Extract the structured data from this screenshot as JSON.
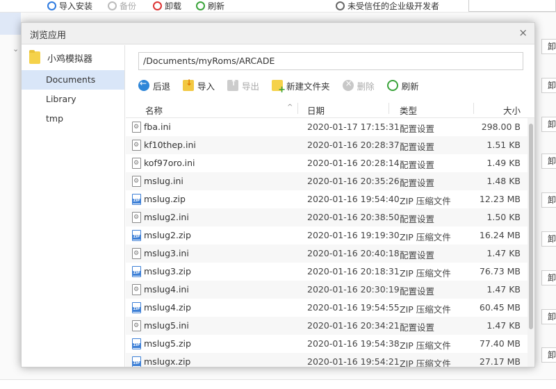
{
  "background": {
    "toolbar": [
      {
        "label": "导入安装",
        "icon": "install-icon",
        "disabled": false
      },
      {
        "label": "备份",
        "icon": "backup-icon",
        "disabled": true
      },
      {
        "label": "卸载",
        "icon": "uninstall-icon",
        "disabled": false
      },
      {
        "label": "刷新",
        "icon": "refresh-icon",
        "disabled": false
      }
    ],
    "notice": "未受信任的企业级开发者",
    "side_button_label": "卸"
  },
  "dialog": {
    "title": "浏览应用",
    "close_label": "×",
    "sidebar": {
      "root": "小鸡模拟器",
      "items": [
        "Documents",
        "Library",
        "tmp"
      ],
      "selected": "Documents"
    },
    "path": "/Documents/myRoms/ARCADE",
    "actions": [
      {
        "label": "后退",
        "icon": "back-icon",
        "disabled": false
      },
      {
        "label": "导入",
        "icon": "import-icon",
        "disabled": false
      },
      {
        "label": "导出",
        "icon": "export-icon",
        "disabled": true
      },
      {
        "label": "新建文件夹",
        "icon": "new-folder-icon",
        "disabled": false
      },
      {
        "label": "删除",
        "icon": "delete-icon",
        "disabled": true
      },
      {
        "label": "刷新",
        "icon": "refresh-icon",
        "disabled": false
      }
    ],
    "columns": {
      "name": "名称",
      "date": "日期",
      "type": "类型",
      "size": "大小"
    },
    "files": [
      {
        "name": "fba.ini",
        "date": "2020-01-17 17:15:31",
        "type": "配置设置",
        "size": "298.00 B",
        "kind": "ini"
      },
      {
        "name": "kf10thep.ini",
        "date": "2020-01-16 20:28:37",
        "type": "配置设置",
        "size": "1.51 KB",
        "kind": "ini"
      },
      {
        "name": "kof97oro.ini",
        "date": "2020-01-16 20:28:14",
        "type": "配置设置",
        "size": "1.49 KB",
        "kind": "ini"
      },
      {
        "name": "mslug.ini",
        "date": "2020-01-16 20:35:26",
        "type": "配置设置",
        "size": "1.48 KB",
        "kind": "ini"
      },
      {
        "name": "mslug.zip",
        "date": "2020-01-16 19:54:40",
        "type": "ZIP 压缩文件",
        "size": "12.23 MB",
        "kind": "zip"
      },
      {
        "name": "mslug2.ini",
        "date": "2020-01-16 20:38:50",
        "type": "配置设置",
        "size": "1.50 KB",
        "kind": "ini"
      },
      {
        "name": "mslug2.zip",
        "date": "2020-01-16 19:19:30",
        "type": "ZIP 压缩文件",
        "size": "16.24 MB",
        "kind": "zip"
      },
      {
        "name": "mslug3.ini",
        "date": "2020-01-16 20:40:18",
        "type": "配置设置",
        "size": "1.47 KB",
        "kind": "ini"
      },
      {
        "name": "mslug3.zip",
        "date": "2020-01-16 20:18:31",
        "type": "ZIP 压缩文件",
        "size": "76.73 MB",
        "kind": "zip"
      },
      {
        "name": "mslug4.ini",
        "date": "2020-01-16 20:30:19",
        "type": "配置设置",
        "size": "1.47 KB",
        "kind": "ini"
      },
      {
        "name": "mslug4.zip",
        "date": "2020-01-16 19:54:55",
        "type": "ZIP 压缩文件",
        "size": "60.45 MB",
        "kind": "zip"
      },
      {
        "name": "mslug5.ini",
        "date": "2020-01-16 20:34:21",
        "type": "配置设置",
        "size": "1.47 KB",
        "kind": "ini"
      },
      {
        "name": "mslug5.zip",
        "date": "2020-01-16 19:54:38",
        "type": "ZIP 压缩文件",
        "size": "77.40 MB",
        "kind": "zip"
      },
      {
        "name": "mslugx.zip",
        "date": "2020-01-16 19:54:21",
        "type": "ZIP 压缩文件",
        "size": "27.17 MB",
        "kind": "zip"
      }
    ]
  }
}
